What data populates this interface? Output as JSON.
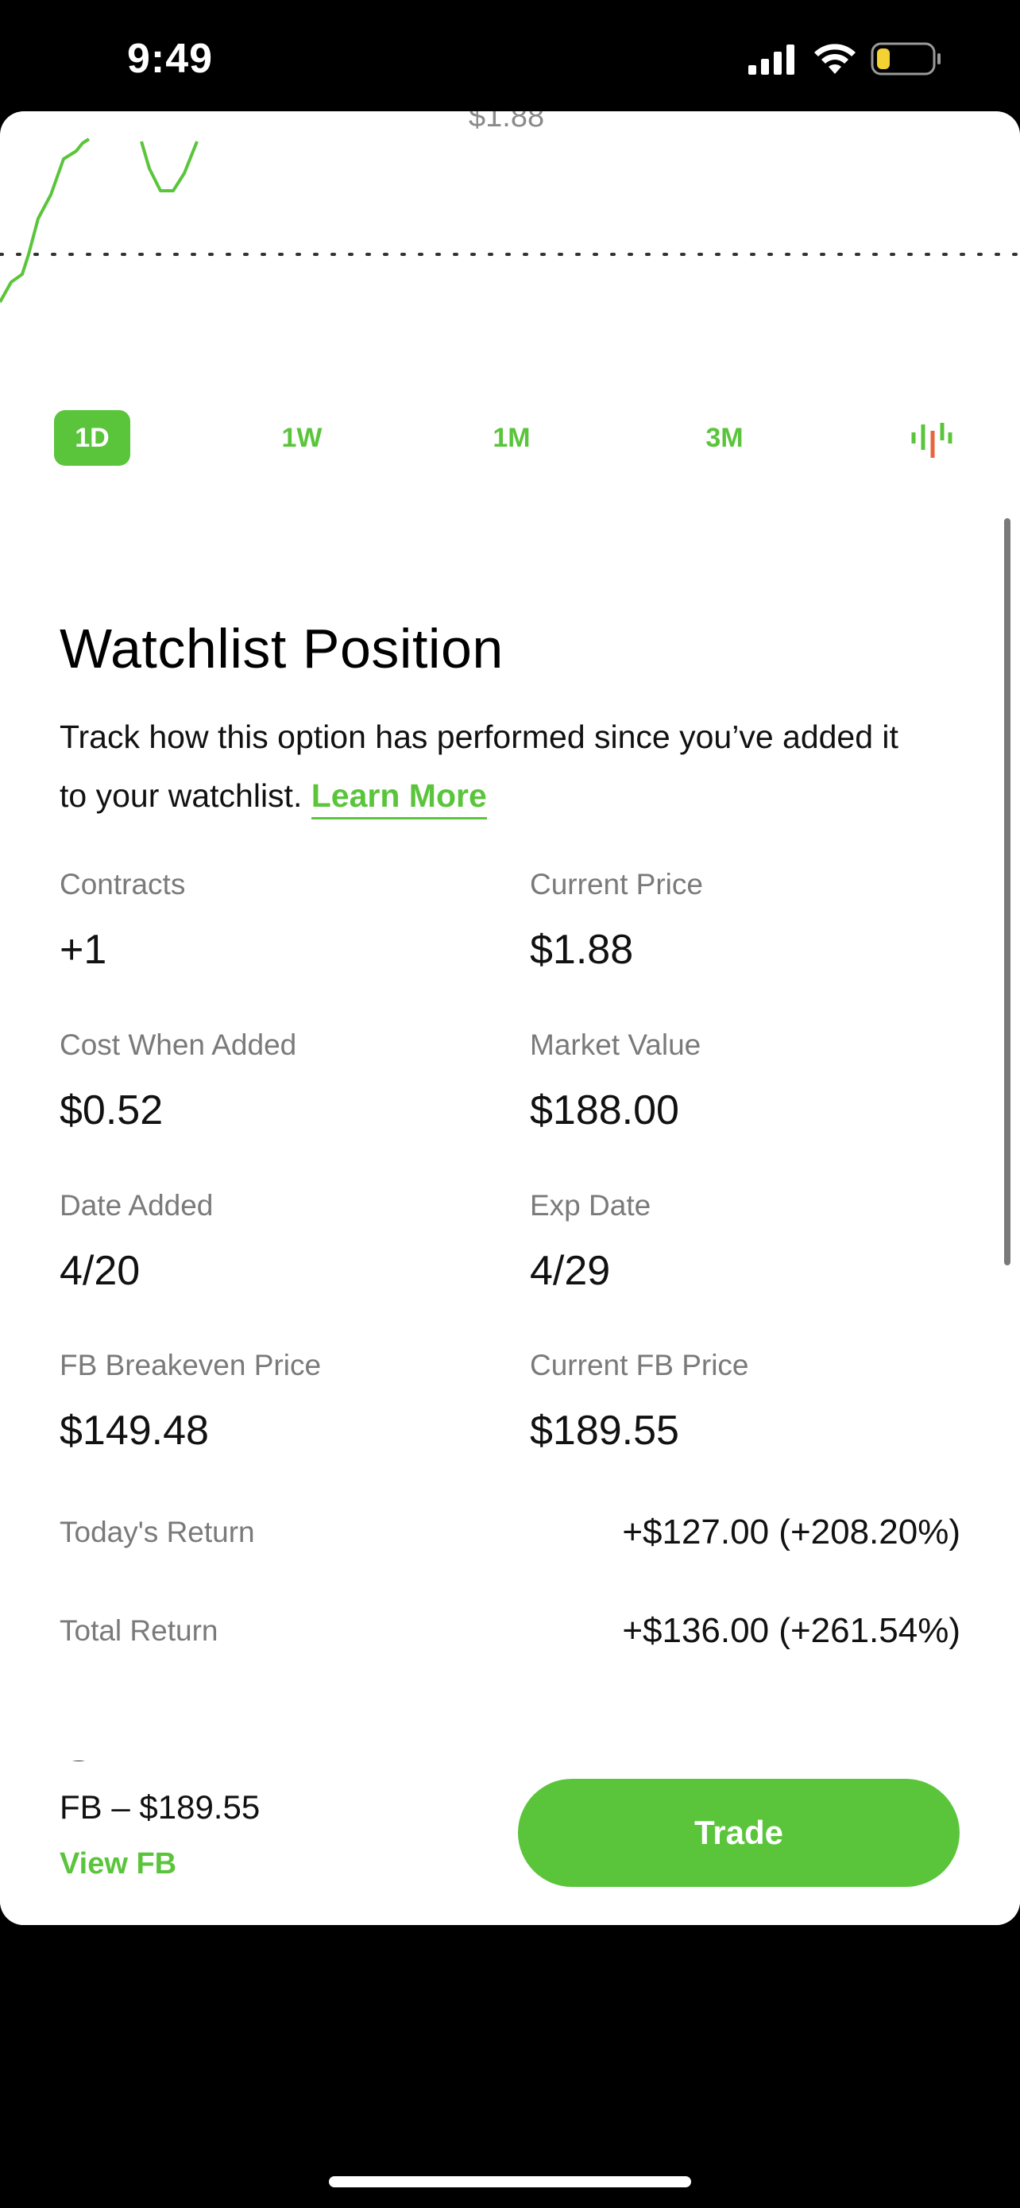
{
  "status_bar": {
    "time": "9:49",
    "icons": [
      "signal-icon",
      "wifi-icon",
      "battery-icon"
    ]
  },
  "chart": {
    "price_label": "$1.88",
    "line_color": "#5ac53b"
  },
  "range_tabs": [
    {
      "label": "1D",
      "active": true
    },
    {
      "label": "1W",
      "active": false
    },
    {
      "label": "1M",
      "active": false
    },
    {
      "label": "3M",
      "active": false
    }
  ],
  "range_chart_type_icon": "candlestick-icon",
  "watchlist": {
    "title": "Watchlist Position",
    "description": "Track how this option has performed since you’ve added it to your watchlist.",
    "learn_more": "Learn More",
    "fields": {
      "contracts": {
        "label": "Contracts",
        "value": "+1"
      },
      "current_price": {
        "label": "Current Price",
        "value": "$1.88"
      },
      "cost_when_added": {
        "label": "Cost When Added",
        "value": "$0.52"
      },
      "market_value": {
        "label": "Market Value",
        "value": "$188.00"
      },
      "date_added": {
        "label": "Date Added",
        "value": "4/20"
      },
      "exp_date": {
        "label": "Exp Date",
        "value": "4/29"
      },
      "breakeven": {
        "label": "FB Breakeven Price",
        "value": "$149.48"
      },
      "current_fb_price": {
        "label": "Current FB Price",
        "value": "$189.55"
      }
    },
    "todays_return": {
      "label": "Today's Return",
      "value": "+$127.00 (+208.20%)"
    },
    "total_return": {
      "label": "Total Return",
      "value": "+$136.00 (+261.54%)"
    }
  },
  "next_section_title": "Stats",
  "bottom_bar": {
    "ticker_price": "FB – $189.55",
    "view_link": "View FB",
    "trade_button": "Trade"
  },
  "colors": {
    "accent": "#5ac53b",
    "candle_down": "#e8643c",
    "label_gray": "#7a7a7a"
  }
}
